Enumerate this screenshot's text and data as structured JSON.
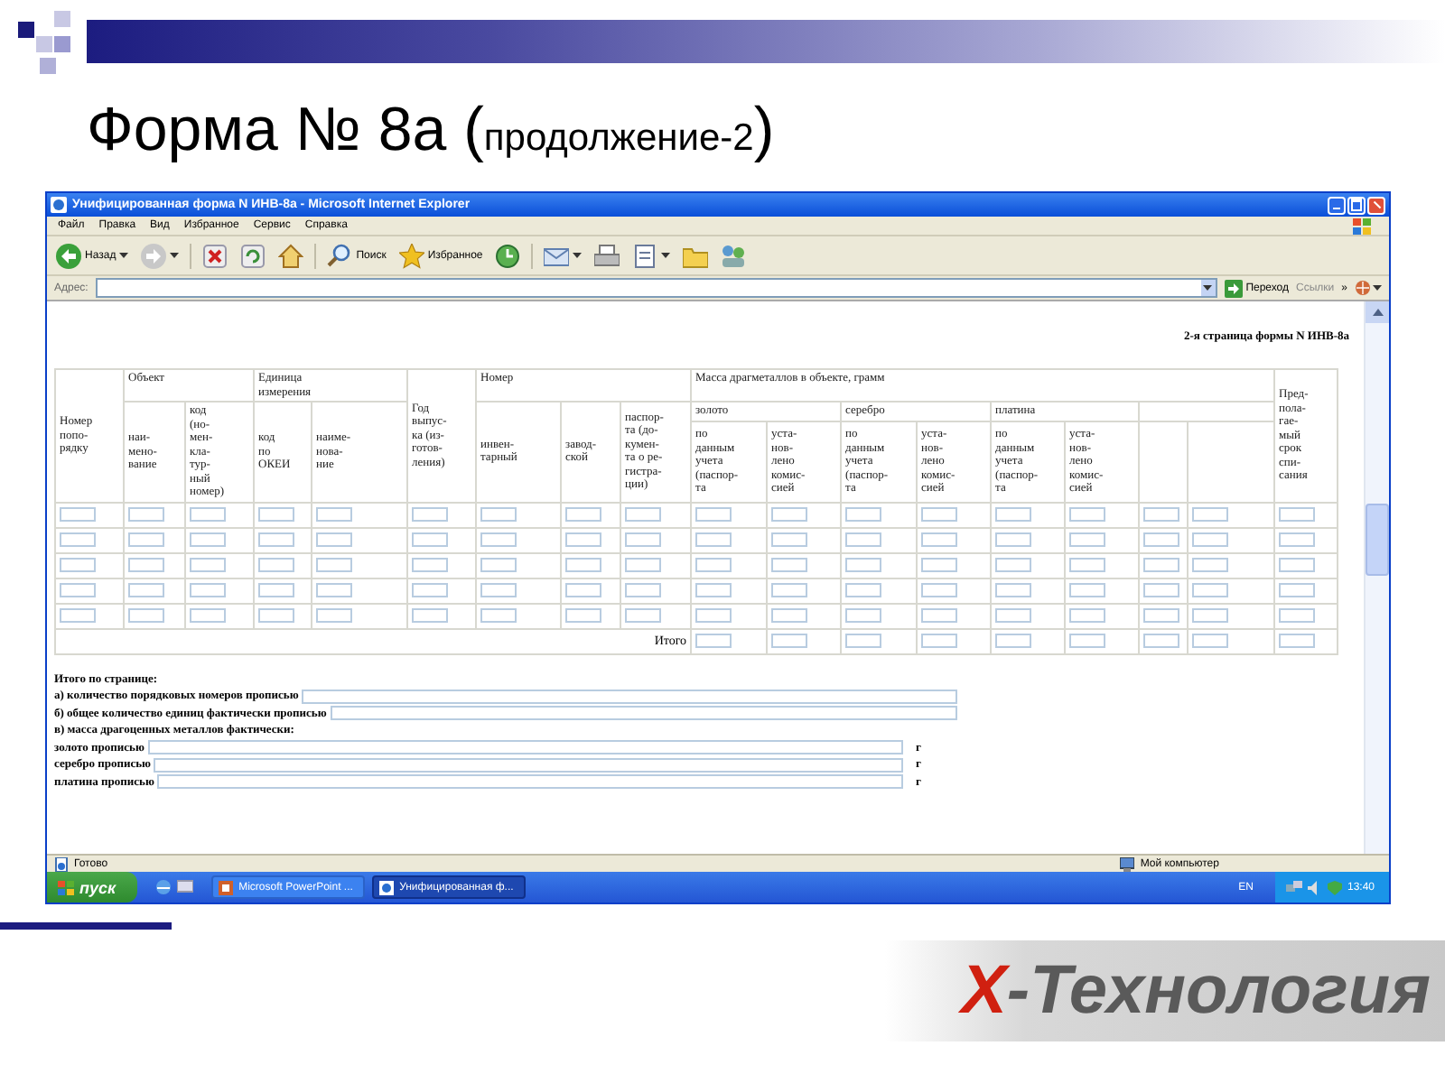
{
  "slide": {
    "title": {
      "lead": "Форма № 8а (",
      "note": "продолжение-2",
      "tail": ")"
    }
  },
  "window": {
    "title": "Унифицированная форма N ИНВ-8а - Microsoft Internet Explorer"
  },
  "menu": [
    "Файл",
    "Правка",
    "Вид",
    "Избранное",
    "Сервис",
    "Справка"
  ],
  "toolbar": [
    {
      "kind": "back",
      "label": "Назад"
    },
    {
      "kind": "forward"
    },
    {
      "kind": "stop"
    },
    {
      "kind": "refresh"
    },
    {
      "kind": "home"
    },
    {
      "kind": "search",
      "label": "Поиск"
    },
    {
      "kind": "favorites",
      "label": "Избранное"
    },
    {
      "kind": "history"
    },
    {
      "kind": "mail"
    },
    {
      "kind": "print"
    },
    {
      "kind": "edit"
    },
    {
      "kind": "folder"
    },
    {
      "kind": "messenger"
    }
  ],
  "address_bar": {
    "label": "Адрес:",
    "go": "Переход",
    "links": "Ссылки",
    "more": "»"
  },
  "page": {
    "caption": "2-я страница формы N ИНВ-8а",
    "table": {
      "columns": [
        {
          "label": "Номер\nпопо-\nрядку",
          "totaled": false
        },
        {
          "label": "Объект",
          "totaled": false,
          "children": [
            {
              "label": "наи-\nмено-\nвание"
            },
            {
              "label": "код\n(но-\nмен-\nкла-\nтур-\nный\nномер)"
            }
          ]
        },
        {
          "label": "Единица\nизмерения",
          "totaled": false,
          "children": [
            {
              "label": "код\nпо\nОКЕИ"
            },
            {
              "label": "наиме-\nнова-\nние"
            }
          ]
        },
        {
          "label": "Год\nвыпус-\nка (из-\nготов-\nления)",
          "totaled": false
        },
        {
          "label": "Номер",
          "totaled": false,
          "children": [
            {
              "label": "инвен-\nтарный"
            },
            {
              "label": "завод-\nской"
            },
            {
              "label": "паспор-\nта (до-\nкумен-\nта о ре-\nгистра-\nции)"
            }
          ]
        },
        {
          "label": "Масса драгметаллов в объекте, грамм",
          "totaled": true,
          "children": [
            {
              "label": "золото",
              "children": [
                {
                  "label": "по\nданным\nучета\n(паспор-\nта"
                },
                {
                  "label": "уста-\nнов-\nлено\nкомис-\nсией"
                }
              ]
            },
            {
              "label": "серебро",
              "children": [
                {
                  "label": "по\nданным\nучета\n(паспор-\nта"
                },
                {
                  "label": "уста-\nнов-\nлено\nкомис-\nсией"
                }
              ]
            },
            {
              "label": "платина",
              "children": [
                {
                  "label": "по\nданным\nучета\n(паспор-\nта"
                },
                {
                  "label": "уста-\nнов-\nлено\nкомис-\nсией"
                }
              ]
            },
            {
              "kind": "blank",
              "children": [
                {
                  "kind": "blank"
                },
                {
                  "kind": "blank"
                }
              ]
            }
          ]
        },
        {
          "label": "Пред-\nпола-\nгае-\nмый\nсрок\nспи-\nсания",
          "totaled": true
        }
      ],
      "total_label": "Итого"
    },
    "summary": [
      {
        "kind": "heading",
        "label": "Итого по странице:"
      },
      {
        "kind": "field",
        "label": "а) количество порядковых номеров прописью"
      },
      {
        "kind": "field",
        "label": "б) общее количество единиц фактически прописью"
      },
      {
        "kind": "heading",
        "label": "в) масса драгоценных металлов фактически:"
      },
      {
        "kind": "field",
        "label": "золото прописью",
        "unit": "г"
      },
      {
        "kind": "field",
        "label": "серебро прописью",
        "unit": "г"
      },
      {
        "kind": "field",
        "label": "платина прописью",
        "unit": "г"
      }
    ]
  },
  "status_bar": {
    "text": "Готово",
    "zone": "Мой компьютер"
  },
  "taskbar": {
    "start": "пуск",
    "tasks": [
      {
        "label": "Microsoft PowerPoint ...",
        "selected": false
      },
      {
        "label": "Унифицированная ф...",
        "selected": true
      }
    ],
    "language": "EN",
    "clock": "13:40"
  },
  "logo": {
    "mark": "X",
    "text": "-Технология"
  }
}
